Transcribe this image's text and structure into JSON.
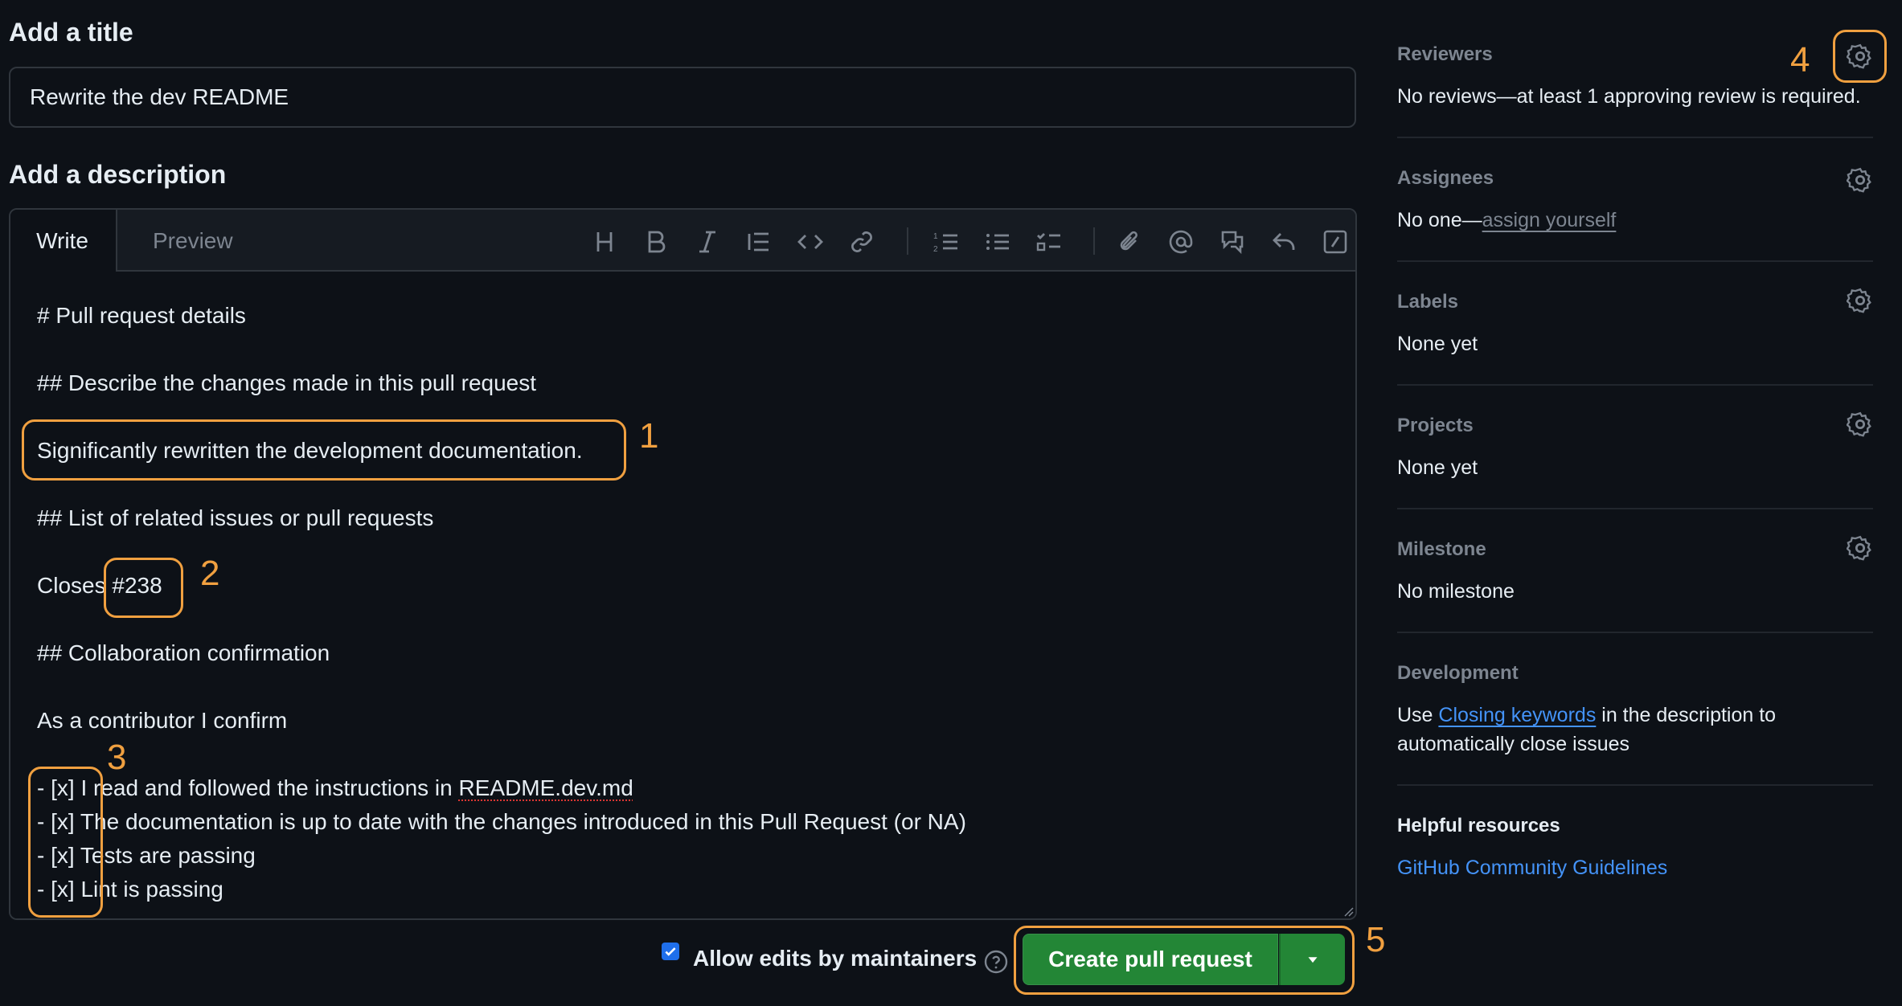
{
  "title_section": {
    "heading": "Add a title",
    "value": "Rewrite the dev README"
  },
  "description_section": {
    "heading": "Add a description",
    "tabs": [
      "Write",
      "Preview"
    ],
    "toolbar_icons": [
      "heading-icon",
      "bold-icon",
      "italic-icon",
      "quote-icon",
      "code-icon",
      "link-icon",
      "ordered-list-icon",
      "unordered-list-icon",
      "task-list-icon",
      "attach-icon",
      "mention-icon",
      "reference-icon",
      "reply-icon",
      "slash-command-icon"
    ],
    "lines": {
      "l1": "# Pull request details",
      "l2": "## Describe the changes made in this pull request",
      "l3": "Significantly rewritten the development documentation.",
      "l4": "## List of related issues or pull requests",
      "l5_prefix": "Closes ",
      "l5_issue": "#238",
      "l6": "## Collaboration confirmation",
      "l7": "As a contributor I confirm",
      "l8_prefix": "- [x] I read and followed the instructions in ",
      "l8_link": "README.dev.md",
      "l9": "- [x] The documentation is up to date with the changes introduced in this Pull Request (or NA)",
      "l10": "- [x] Tests are passing",
      "l11": "- [x] Lint is passing"
    }
  },
  "annotations": {
    "n1": "1",
    "n2": "2",
    "n3": "3",
    "n4": "4",
    "n5": "5",
    "color": "#f0a040"
  },
  "sidebar": {
    "reviewers": {
      "label": "Reviewers",
      "value": "No reviews—at least 1 approving review is required."
    },
    "assignees": {
      "label": "Assignees",
      "value_prefix": "No one—",
      "value_link": "assign yourself"
    },
    "labels": {
      "label": "Labels",
      "value": "None yet"
    },
    "projects": {
      "label": "Projects",
      "value": "None yet"
    },
    "milestone": {
      "label": "Milestone",
      "value": "No milestone"
    },
    "development": {
      "label": "Development",
      "text_prefix": "Use ",
      "link": "Closing keywords",
      "text_suffix": " in the description to",
      "text_line2": "automatically close issues"
    },
    "helpful": {
      "label": "Helpful resources",
      "link": "GitHub Community Guidelines"
    }
  },
  "footer": {
    "allow_edits_label": "Allow edits by maintainers",
    "allow_edits_checked": true,
    "create_button": "Create pull request"
  },
  "colors": {
    "background": "#0d1117",
    "button_green": "#238636",
    "link_blue": "#4493f8",
    "annotation_orange": "#f0a040"
  }
}
